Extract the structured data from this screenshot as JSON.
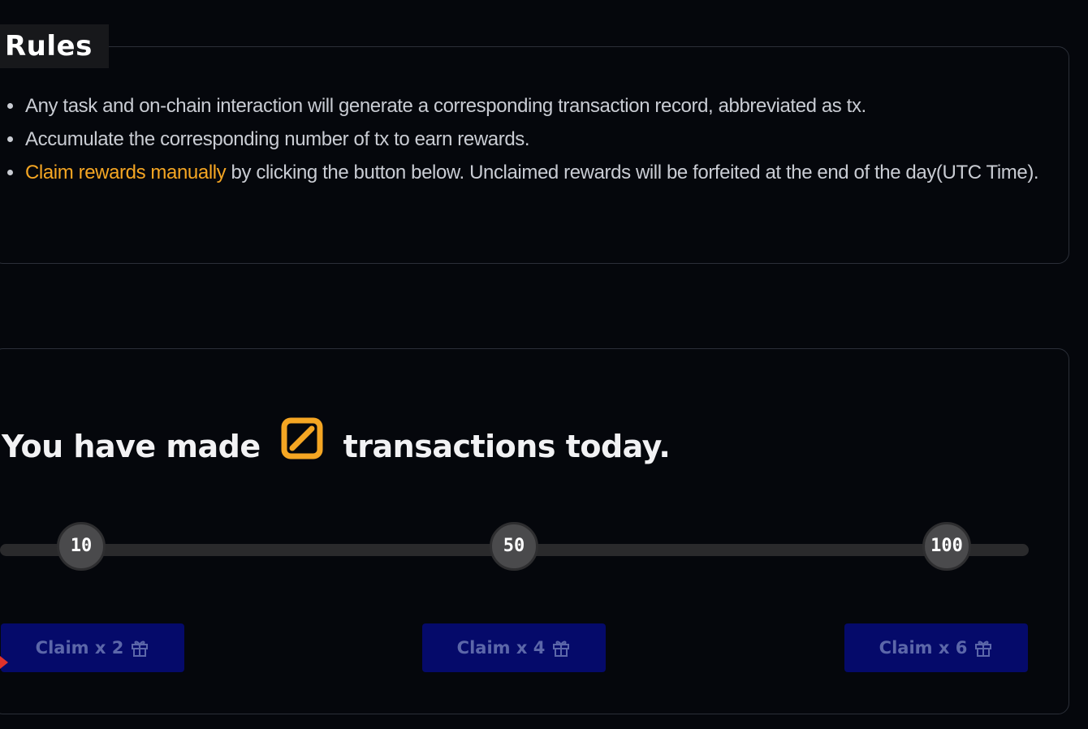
{
  "rules": {
    "title": "Rules",
    "items": [
      {
        "text": "Any task and on-chain interaction will generate a corresponding transaction record, abbreviated as tx."
      },
      {
        "text": "Accumulate the corresponding number of tx to earn rewards."
      },
      {
        "highlight": "Claim rewards manually",
        "text": " by clicking the button below. Unclaimed rewards will be forfeited at the end of the day(UTC Time)."
      }
    ]
  },
  "progress": {
    "headline_before": "You have made",
    "tx_count": "0",
    "headline_after": "transactions today.",
    "milestones": [
      {
        "value": "10"
      },
      {
        "value": "50"
      },
      {
        "value": "100"
      }
    ],
    "claims": [
      {
        "label": "Claim x 2",
        "icon": "gift-icon"
      },
      {
        "label": "Claim x 4",
        "icon": "gift-icon"
      },
      {
        "label": "Claim x 6",
        "icon": "gift-icon"
      }
    ]
  },
  "colors": {
    "accent": "#f5a623",
    "claim_button_bg": "#050a6a",
    "claim_button_text": "#5c67a9",
    "milestone_bg": "#4a4a4c",
    "track": "#2a2a2c"
  }
}
